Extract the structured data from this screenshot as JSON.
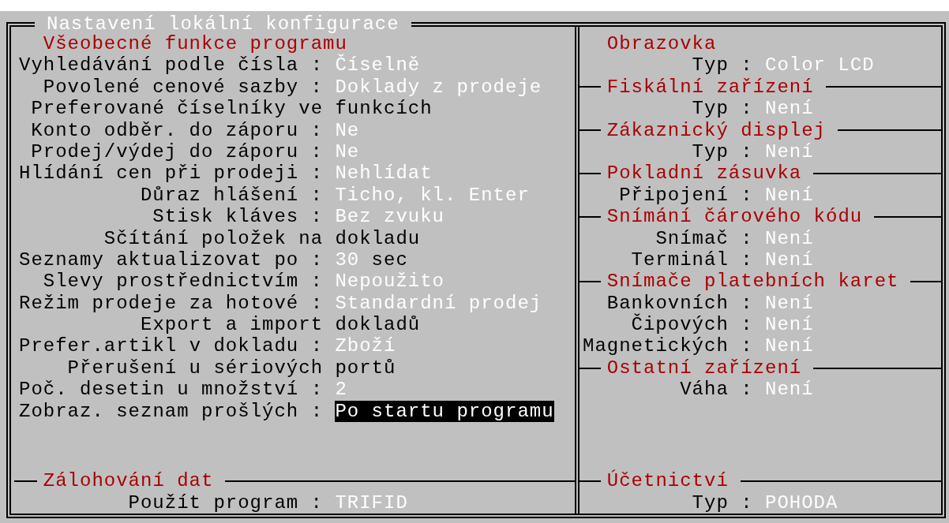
{
  "window": {
    "title": "Nastavení lokální konfigurace"
  },
  "left_panel": {
    "sections": [
      {
        "heading": "Všeobecné funkce programu",
        "items": [
          {
            "kind": "field",
            "label": "Vyhledávání podle čísla :",
            "value": "Číselně",
            "selected": false
          },
          {
            "kind": "field",
            "label": "Povolené cenové sazby :",
            "value": "Doklady z prodeje",
            "selected": false
          },
          {
            "kind": "submenu",
            "text": "Preferované číselníky ve funkcích",
            "selected": false
          },
          {
            "kind": "field",
            "label": "Konto odběr. do záporu :",
            "value": "Ne",
            "selected": false
          },
          {
            "kind": "field",
            "label": "Prodej/výdej do záporu :",
            "value": "Ne",
            "selected": false
          },
          {
            "kind": "field",
            "label": "Hlídání cen při prodeji :",
            "value": "Nehlídat",
            "selected": false
          },
          {
            "kind": "field",
            "label": "Důraz hlášení :",
            "value": "Ticho, kl. Enter",
            "selected": false
          },
          {
            "kind": "field",
            "label": "Stisk kláves :",
            "value": "Bez zvuku",
            "selected": false
          },
          {
            "kind": "submenu",
            "text": "Sčítání položek na dokladu",
            "selected": false
          },
          {
            "kind": "number",
            "label": "Seznamy aktualizovat po :",
            "value": "30",
            "unit": "sec",
            "selected": false
          },
          {
            "kind": "field",
            "label": "Slevy prostřednictvím :",
            "value": "Nepoužito",
            "selected": false
          },
          {
            "kind": "field",
            "label": "Režim prodeje za hotové :",
            "value": "Standardní prodej",
            "selected": false
          },
          {
            "kind": "submenu",
            "text": "Export a import dokladů",
            "selected": false
          },
          {
            "kind": "field",
            "label": "Prefer.artikl v dokladu :",
            "value": "Zboží",
            "selected": false
          },
          {
            "kind": "submenu",
            "text": "Přerušení u sériových portů",
            "selected": false
          },
          {
            "kind": "field",
            "label": "Poč. desetin u množství :",
            "value": "2",
            "selected": false
          },
          {
            "kind": "field",
            "label": "Zobraz. seznam prošlých :",
            "value": "Po startu programu",
            "selected": true
          }
        ]
      },
      {
        "heading": "Zálohování dat",
        "items": [
          {
            "kind": "field",
            "label": "Použít program :",
            "value": "TRIFID",
            "selected": false
          }
        ]
      }
    ]
  },
  "right_panel": {
    "sections": [
      {
        "heading": "Obrazovka",
        "items": [
          {
            "kind": "field",
            "label": "Typ :",
            "value": "Color LCD",
            "selected": false
          }
        ]
      },
      {
        "heading": "Fiskální zařízení",
        "items": [
          {
            "kind": "field",
            "label": "Typ :",
            "value": "Není",
            "selected": false
          }
        ]
      },
      {
        "heading": "Zákaznický displej",
        "items": [
          {
            "kind": "field",
            "label": "Typ :",
            "value": "Není",
            "selected": false
          }
        ]
      },
      {
        "heading": "Pokladní zásuvka",
        "items": [
          {
            "kind": "field",
            "label": "Připojení :",
            "value": "Není",
            "selected": false
          }
        ]
      },
      {
        "heading": "Snímání čárového kódu",
        "items": [
          {
            "kind": "field",
            "label": "Snímač :",
            "value": "Není",
            "selected": false
          },
          {
            "kind": "field",
            "label": "Terminál :",
            "value": "Není",
            "selected": false
          }
        ]
      },
      {
        "heading": "Snímače platebních karet",
        "items": [
          {
            "kind": "field",
            "label": "Bankovních :",
            "value": "Není",
            "selected": false
          },
          {
            "kind": "field",
            "label": "Čipových :",
            "value": "Není",
            "selected": false
          },
          {
            "kind": "field",
            "label": "Magnetických :",
            "value": "Není",
            "selected": false
          }
        ]
      },
      {
        "heading": "Ostatní zařízení",
        "items": [
          {
            "kind": "field",
            "label": "Váha :",
            "value": "Není",
            "selected": false
          }
        ]
      },
      {
        "heading": "Účetnictví",
        "items": [
          {
            "kind": "field",
            "label": "Typ :",
            "value": "POHODA",
            "selected": false
          }
        ]
      }
    ]
  }
}
